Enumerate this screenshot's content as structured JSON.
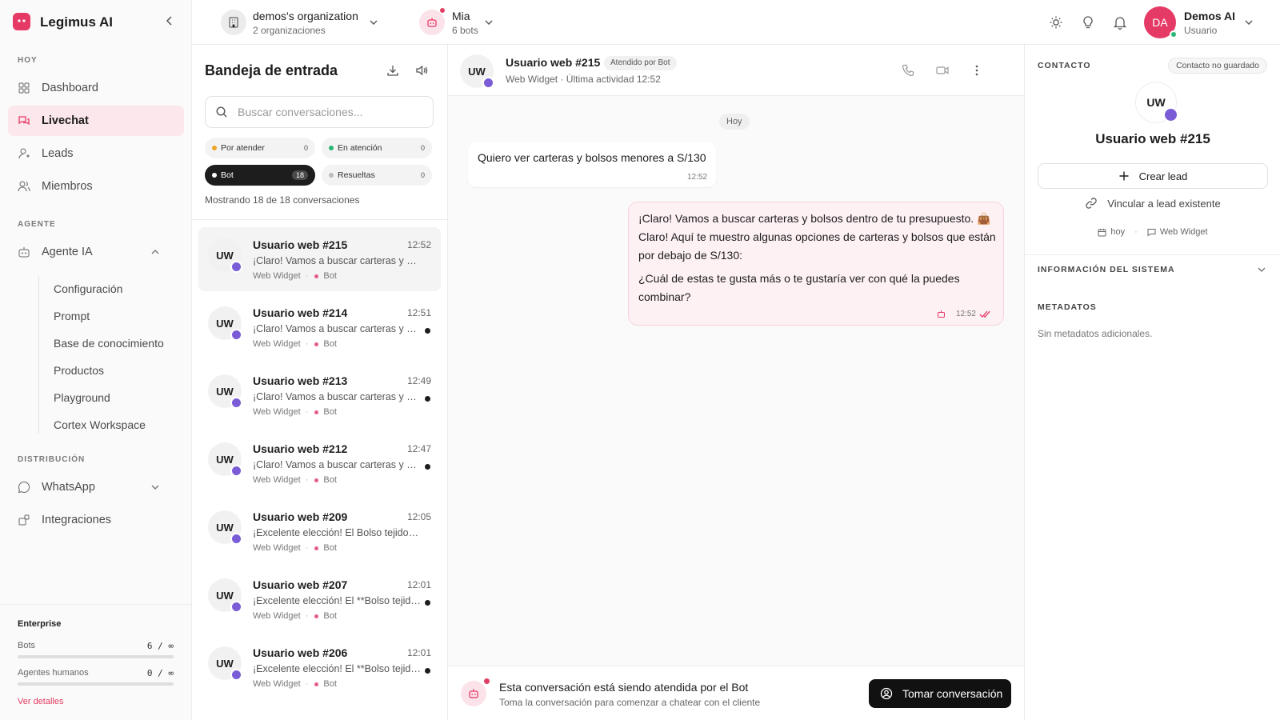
{
  "app": {
    "name": "Legimus AI"
  },
  "colors": {
    "brand": "#e53a66",
    "bot_badge": "#7a5cd6",
    "online": "#2bb673"
  },
  "sidebar": {
    "sections": {
      "hoy": "HOY",
      "agente": "AGENTE",
      "distribucion": "DISTRIBUCIÓN"
    },
    "items": [
      {
        "label": "Dashboard",
        "icon": "grid-icon"
      },
      {
        "label": "Livechat",
        "icon": "chat-icon"
      },
      {
        "label": "Leads",
        "icon": "user-icon"
      },
      {
        "label": "Miembros",
        "icon": "users-icon"
      },
      {
        "label": "Agente IA",
        "icon": "robot-icon"
      },
      {
        "label": "WhatsApp",
        "icon": "whatsapp-icon"
      },
      {
        "label": "Integraciones",
        "icon": "puzzle-icon"
      }
    ],
    "subitems": [
      "Configuración",
      "Prompt",
      "Base de conocimiento",
      "Productos",
      "Playground",
      "Cortex Workspace"
    ],
    "plan": {
      "title": "Enterprise",
      "bots_label": "Bots",
      "bots_value": "6 / ∞",
      "agents_label": "Agentes humanos",
      "agents_value": "0 / ∞",
      "details_link": "Ver detalles"
    }
  },
  "topbar": {
    "org_name": "demos's organization",
    "org_sub": "2 organizaciones",
    "bot_name": "Mia",
    "bot_sub": "6 bots",
    "user_initials": "DA",
    "user_name": "Demos AI",
    "user_role": "Usuario"
  },
  "inbox": {
    "title": "Bandeja de entrada",
    "search_placeholder": "Buscar conversaciones...",
    "filters": [
      {
        "label": "Por atender",
        "count": "0",
        "color": "#f0a428"
      },
      {
        "label": "En atención",
        "count": "0",
        "color": "#2bb673"
      },
      {
        "label": "Bot",
        "count": "18",
        "color": "#ffffff"
      },
      {
        "label": "Resueltas",
        "count": "0",
        "color": "#bdbdbd"
      }
    ],
    "showing": "Mostrando 18 de 18 conversaciones",
    "conversations": [
      {
        "initials": "UW",
        "name": "Usuario web #215",
        "time": "12:52",
        "preview": "¡Claro! Vamos a buscar carteras y bolsos dentro de tu presupuesto.",
        "channel": "Web Widget",
        "handler": "Bot"
      },
      {
        "initials": "UW",
        "name": "Usuario web #214",
        "time": "12:51",
        "preview": "¡Claro! Vamos a buscar carteras y bolsos",
        "channel": "Web Widget",
        "handler": "Bot"
      },
      {
        "initials": "UW",
        "name": "Usuario web #213",
        "time": "12:49",
        "preview": "¡Claro! Vamos a buscar carteras y bolsos",
        "channel": "Web Widget",
        "handler": "Bot"
      },
      {
        "initials": "UW",
        "name": "Usuario web #212",
        "time": "12:47",
        "preview": "¡Claro! Vamos a buscar carteras y bolsos",
        "channel": "Web Widget",
        "handler": "Bot"
      },
      {
        "initials": "UW",
        "name": "Usuario web #209",
        "time": "12:05",
        "preview": "¡Excelente elección! El Bolso tejido a mano",
        "channel": "Web Widget",
        "handler": "Bot"
      },
      {
        "initials": "UW",
        "name": "Usuario web #207",
        "time": "12:01",
        "preview": "¡Excelente elección! El **Bolso tejido**",
        "channel": "Web Widget",
        "handler": "Bot"
      },
      {
        "initials": "UW",
        "name": "Usuario web #206",
        "time": "12:01",
        "preview": "¡Excelente elección! El **Bolso tejido**",
        "channel": "Web Widget",
        "handler": "Bot"
      }
    ]
  },
  "chat": {
    "initials": "UW",
    "name": "Usuario web #215",
    "tag": "Atendido por Bot",
    "sub": "Web Widget · Última actividad 12:52",
    "day": "Hoy",
    "incoming": {
      "text": "Quiero ver carteras y bolsos menores a S/130",
      "time": "12:52"
    },
    "outgoing": {
      "text1": "¡Claro! Vamos a buscar carteras y bolsos dentro de tu presupuesto. 👜Claro! Aquí te muestro algunas opciones de carteras y bolsos que están por debajo de S/130:",
      "text2": "¿Cuál de estas te gusta más o te gustaría ver con qué la puedes combinar?",
      "time": "12:52"
    },
    "footer": {
      "title": "Esta conversación está siendo atendida por el Bot",
      "sub": "Toma la conversación para comenzar a chatear con el cliente",
      "button": "Tomar conversación"
    }
  },
  "contact": {
    "label": "CONTACTO",
    "tag": "Contacto no guardado",
    "initials": "UW",
    "name": "Usuario web #215",
    "create_lead": "Crear lead",
    "link_lead": "Vincular a lead existente",
    "date": "hoy",
    "channel": "Web Widget",
    "system_label": "INFORMACIÓN DEL SISTEMA",
    "metadata_label": "METADATOS",
    "metadata_empty": "Sin metadatos adicionales."
  }
}
